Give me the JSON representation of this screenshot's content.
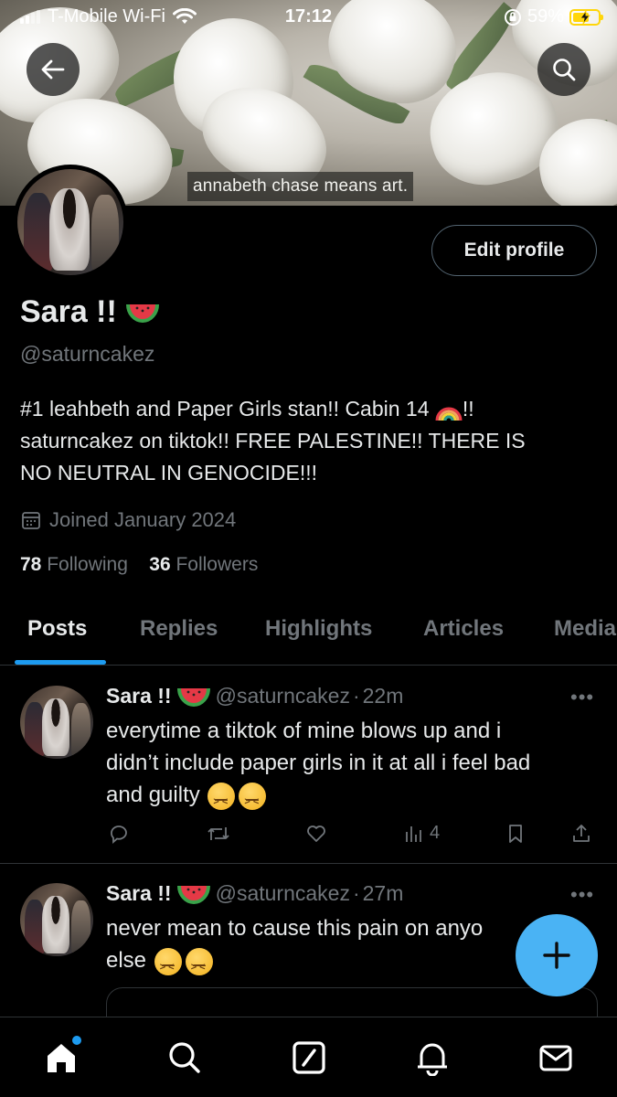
{
  "status_bar": {
    "carrier": "T-Mobile Wi-Fi",
    "time": "17:12",
    "battery": "59%",
    "battery_level": 0.59
  },
  "banner": {
    "caption": "annabeth chase means art."
  },
  "header": {
    "back_icon": "back-arrow-icon",
    "search_icon": "search-icon"
  },
  "profile": {
    "name": "Sara !!",
    "handle": "@saturncakez",
    "bio": "#1 leahbeth and Paper Girls stan!! Cabin 14 🌈!! saturncakez on tiktok!! FREE PALESTINE!! THERE IS NO NEUTRAL IN GENOCIDE!!!",
    "bio_line1_a": "#1 leahbeth and Paper Girls stan!! Cabin 14",
    "bio_line1_b": "!!",
    "bio_line2": "saturncakez on tiktok!! FREE PALESTINE!! THERE IS",
    "bio_line3": "NO NEUTRAL IN GENOCIDE!!!",
    "joined": "Joined January 2024",
    "following_count": "78",
    "following_label": "Following",
    "followers_count": "36",
    "followers_label": "Followers",
    "edit_label": "Edit profile"
  },
  "tabs": [
    {
      "label": "Posts",
      "active": true
    },
    {
      "label": "Replies",
      "active": false
    },
    {
      "label": "Highlights",
      "active": false
    },
    {
      "label": "Articles",
      "active": false
    },
    {
      "label": "Media",
      "active": false
    }
  ],
  "posts": [
    {
      "name": "Sara !!",
      "handle": "@saturncakez",
      "sep": "·",
      "time": "22m",
      "more": "•••",
      "line1": "everytime a tiktok of mine blows up and i",
      "line2": "didn’t include paper girls in it at all i feel bad",
      "line3": "and guilty",
      "views": "4"
    },
    {
      "name": "Sara !!",
      "handle": "@saturncakez",
      "sep": "·",
      "time": "27m",
      "more": "•••",
      "line1": "never mean to cause this pain on anyo",
      "line2": "else"
    }
  ],
  "colors": {
    "accent": "#1d9bf0",
    "fab": "#4ab3f4",
    "secondary_text": "#71767b",
    "border": "#2f3336"
  },
  "nav": [
    "home-icon",
    "search-icon",
    "grok-icon",
    "notifications-icon",
    "messages-icon"
  ]
}
